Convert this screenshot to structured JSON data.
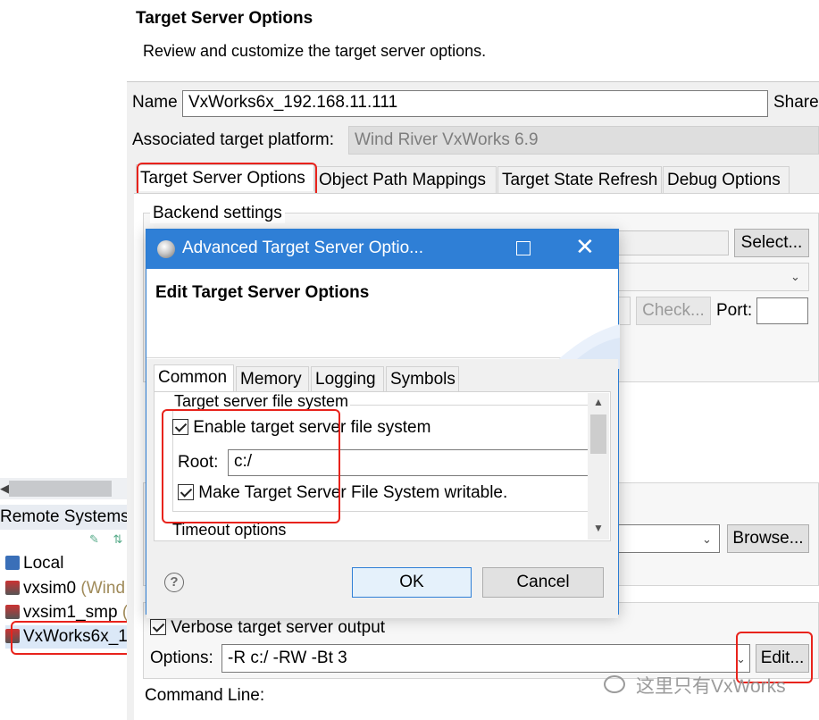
{
  "header": {
    "title": "Target Server Options",
    "subtitle": "Review and customize the target server options."
  },
  "name_row": {
    "label": "Name",
    "value": "VxWorks6x_192.168.11.111",
    "share_label": "Share"
  },
  "platform_row": {
    "label": "Associated target platform:",
    "value": "Wind River VxWorks 6.9"
  },
  "tabs": [
    {
      "label": "Target Server Options",
      "active": true
    },
    {
      "label": "Object Path Mappings",
      "active": false
    },
    {
      "label": "Target State Refresh",
      "active": false
    },
    {
      "label": "Debug Options",
      "active": false
    }
  ],
  "backend": {
    "group_label": "Backend settings",
    "select_button": "Select...",
    "check_button": "Check...",
    "port_label": "Port:"
  },
  "kernel": {
    "browse_button": "Browse..."
  },
  "options": {
    "verbose_label": "Verbose target server output",
    "verbose_checked": true,
    "options_label": "Options:",
    "options_value": "-R c:/ -RW -Bt 3",
    "edit_button": "Edit...",
    "command_line_label": "Command Line:"
  },
  "remote_systems": {
    "title": "Remote Systems",
    "items": [
      {
        "label": "Local",
        "note": ""
      },
      {
        "label": "vxsim0",
        "note": " (Wind"
      },
      {
        "label": "vxsim1_smp",
        "note": " ("
      },
      {
        "label": "VxWorks6x_1",
        "note": ""
      }
    ]
  },
  "modal": {
    "window_title": "Advanced Target Server Optio...",
    "header_title": "Edit Target Server Options",
    "tabs": [
      {
        "label": "Common",
        "active": true
      },
      {
        "label": "Memory",
        "active": false
      },
      {
        "label": "Logging",
        "active": false
      },
      {
        "label": "Symbols",
        "active": false
      }
    ],
    "fs_group_label": "Target server file system",
    "enable_fs_label": "Enable target server file system",
    "enable_fs_checked": true,
    "root_label": "Root:",
    "root_value": "c:/",
    "writable_label": "Make Target Server File System writable.",
    "writable_checked": true,
    "timeout_group_label": "Timeout options",
    "ok_button": "OK",
    "cancel_button": "Cancel"
  },
  "watermark": {
    "text": "这里只有VxWorks"
  },
  "colors": {
    "accent_blue": "#2f7fd6",
    "highlight_red": "#e8231c"
  }
}
